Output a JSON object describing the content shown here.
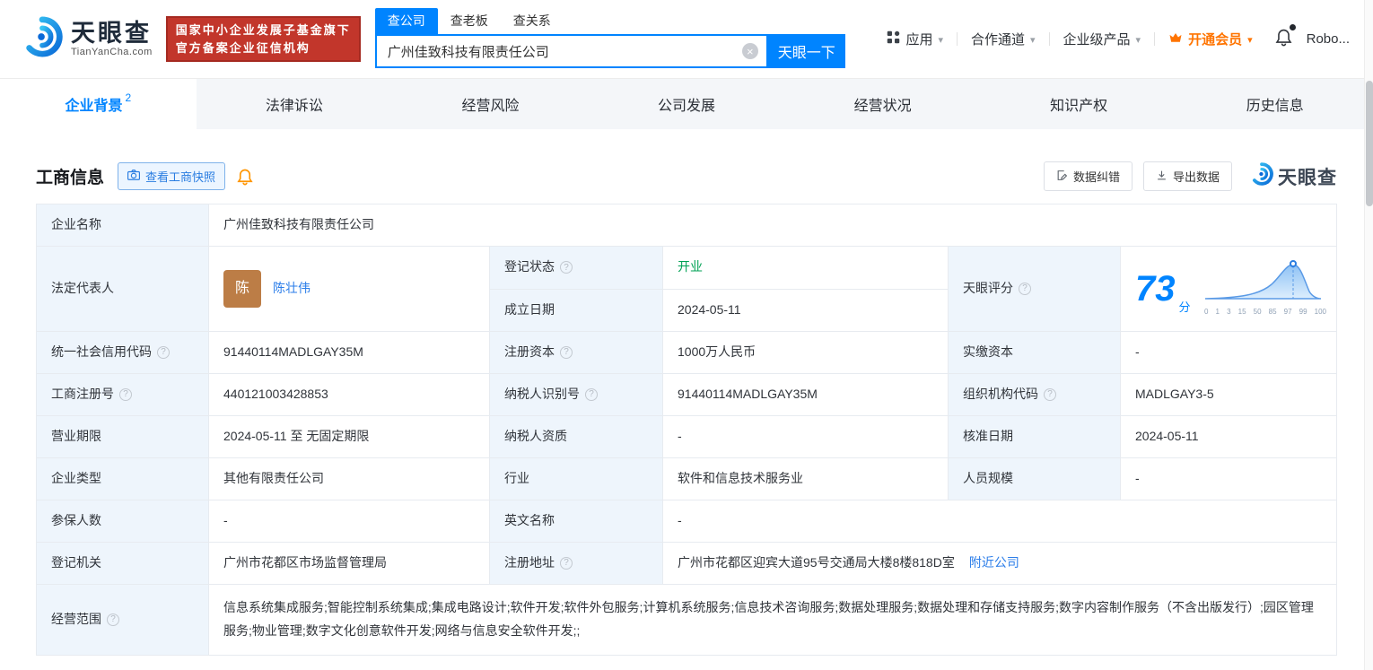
{
  "colors": {
    "accent": "#0084ff",
    "green": "#00a154",
    "orange": "#ff7400",
    "badge_red": "#c2362b",
    "link_blue": "#2b7de9",
    "label_bg": "#eef5fc"
  },
  "header": {
    "logo": {
      "title": "天眼查",
      "subtitle": "TianYanCha.com"
    },
    "badge": {
      "line1": "国家中小企业发展子基金旗下",
      "line2": "官方备案企业征信机构"
    },
    "search": {
      "tabs": [
        {
          "label": "查公司"
        },
        {
          "label": "查老板"
        },
        {
          "label": "查关系"
        }
      ],
      "value": "广州佳致科技有限责任公司",
      "button": "天眼一下"
    },
    "menu": [
      {
        "label": "应用"
      },
      {
        "label": "合作通道"
      },
      {
        "label": "企业级产品"
      },
      {
        "label": "开通会员"
      }
    ],
    "user": "Robo..."
  },
  "nav": {
    "tabs": [
      {
        "label": "企业背景",
        "badge": "2"
      },
      {
        "label": "法律诉讼"
      },
      {
        "label": "经营风险"
      },
      {
        "label": "公司发展"
      },
      {
        "label": "经营状况"
      },
      {
        "label": "知识产权"
      },
      {
        "label": "历史信息"
      }
    ]
  },
  "section": {
    "title": "工商信息",
    "snapshot_button": "查看工商快照",
    "correction_button": "数据纠错",
    "export_button": "导出数据",
    "watermark": "天眼查"
  },
  "info": {
    "company_name": {
      "label": "企业名称",
      "value": "广州佳致科技有限责任公司"
    },
    "legal_rep": {
      "label": "法定代表人",
      "avatar": "陈",
      "value": "陈壮伟"
    },
    "reg_status": {
      "label": "登记状态",
      "value": "开业"
    },
    "establish_date": {
      "label": "成立日期",
      "value": "2024-05-11"
    },
    "score": {
      "label": "天眼评分",
      "value": "73",
      "unit": "分",
      "axis": [
        "0",
        "1",
        "3",
        "15",
        "50",
        "85",
        "97",
        "99",
        "100"
      ]
    },
    "credit_code": {
      "label": "统一社会信用代码",
      "value": "91440114MADLGAY35M"
    },
    "reg_capital": {
      "label": "注册资本",
      "value": "1000万人民币"
    },
    "paid_capital": {
      "label": "实缴资本",
      "value": "-"
    },
    "reg_number": {
      "label": "工商注册号",
      "value": "440121003428853"
    },
    "taxpayer_id": {
      "label": "纳税人识别号",
      "value": "91440114MADLGAY35M"
    },
    "org_code": {
      "label": "组织机构代码",
      "value": "MADLGAY3-5"
    },
    "business_term": {
      "label": "营业期限",
      "value": "2024-05-11 至 无固定期限"
    },
    "taxpayer_qualification": {
      "label": "纳税人资质",
      "value": "-"
    },
    "approval_date": {
      "label": "核准日期",
      "value": "2024-05-11"
    },
    "company_type": {
      "label": "企业类型",
      "value": "其他有限责任公司"
    },
    "industry": {
      "label": "行业",
      "value": "软件和信息技术服务业"
    },
    "staff_size": {
      "label": "人员规模",
      "value": "-"
    },
    "insured_count": {
      "label": "参保人数",
      "value": "-"
    },
    "english_name": {
      "label": "英文名称",
      "value": "-"
    },
    "reg_authority": {
      "label": "登记机关",
      "value": "广州市花都区市场监督管理局"
    },
    "reg_address": {
      "label": "注册地址",
      "value": "广州市花都区迎宾大道95号交通局大楼8楼818D室",
      "link": "附近公司"
    },
    "business_scope": {
      "label": "经营范围",
      "value": "信息系统集成服务;智能控制系统集成;集成电路设计;软件开发;软件外包服务;计算机系统服务;信息技术咨询服务;数据处理服务;数据处理和存储支持服务;数字内容制作服务（不含出版发行）;园区管理服务;物业管理;数字文化创意软件开发;网络与信息安全软件开发;;"
    }
  }
}
